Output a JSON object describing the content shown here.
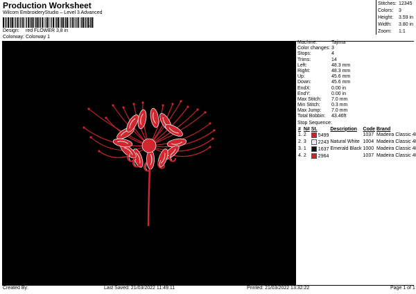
{
  "header": {
    "title": "Production Worksheet",
    "software": "Wilcom EmbroideryStudio – Level 3 Advanced",
    "barcode_mark": ",",
    "design_label": "Design:",
    "design_value": "red FLOWER 3,8 in",
    "colorway_label": "Colorway:",
    "colorway_value": "Colorway 1"
  },
  "summary": [
    {
      "label": "Stitches:",
      "value": "12345"
    },
    {
      "label": "Colors:",
      "value": "3"
    },
    {
      "label": "Height:",
      "value": "3.59 in"
    },
    {
      "label": "Width:",
      "value": "3.80 in"
    },
    {
      "label": "Zoom:",
      "value": "1:1"
    }
  ],
  "details": [
    {
      "label": "Machine:",
      "value": "Tajima"
    },
    {
      "label": "Color changes:",
      "value": "3"
    },
    {
      "label": "Stops:",
      "value": "4"
    },
    {
      "label": "Trims:",
      "value": "14"
    },
    {
      "label": "Left:",
      "value": "48.3 mm"
    },
    {
      "label": "Right:",
      "value": "48.3 mm"
    },
    {
      "label": "Up:",
      "value": "45.6 mm"
    },
    {
      "label": "Down:",
      "value": "45.6 mm"
    },
    {
      "label": "EndX:",
      "value": "0.00 in"
    },
    {
      "label": "EndY:",
      "value": "0.00 in"
    },
    {
      "label": "Max Stitch:",
      "value": "7.0 mm"
    },
    {
      "label": "Min Stitch:",
      "value": "0.3 mm"
    },
    {
      "label": "Max Jump:",
      "value": "7.0 mm"
    },
    {
      "label": "Total Bobbin:",
      "value": "43.46ft"
    }
  ],
  "stop_sequence": {
    "title": "Stop Sequence:",
    "headers": [
      "#",
      "N#",
      "St.",
      "Description",
      "Code",
      "Brand"
    ],
    "rows": [
      {
        "num": "1.",
        "n": "2",
        "color": "#c8242c",
        "st": "5499",
        "desc": "",
        "code": "1037",
        "brand": "Madeira Classic 40"
      },
      {
        "num": "2.",
        "n": "3",
        "color": "#e9eef2",
        "st": "2243",
        "desc": "Natural White",
        "code": "1004",
        "brand": "Madeira Classic 40"
      },
      {
        "num": "3.",
        "n": "1",
        "color": "#111111",
        "st": "1637",
        "desc": "Emerald Black",
        "code": "1000",
        "brand": "Madeira Classic 40"
      },
      {
        "num": "4.",
        "n": "2",
        "color": "#c8242c",
        "st": "2964",
        "desc": "",
        "code": "1037",
        "brand": "Madeira Classic 40"
      }
    ]
  },
  "footer": {
    "created": "Created By:",
    "saved": "Last Saved: 21/03/2022 11:49:11",
    "printed": "Printed: 21/03/2022 13:32:22",
    "page": "Page 1 of 1"
  },
  "colors": {
    "red": "#d2262e",
    "white": "#e8e8e8",
    "background": "#000000"
  }
}
